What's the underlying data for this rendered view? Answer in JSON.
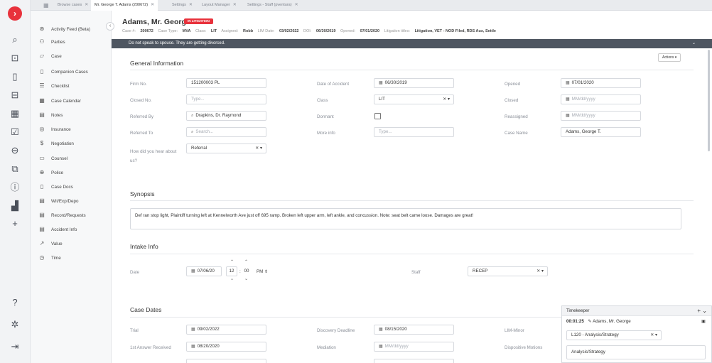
{
  "rail": {
    "logo": "›"
  },
  "tabs": [
    {
      "label": "Browse cases",
      "active": false
    },
    {
      "label": "Mr. George T. Adams (200672)",
      "active": true
    },
    {
      "label": "Settings",
      "active": false
    },
    {
      "label": "Layout Manager",
      "active": false
    },
    {
      "label": "Settings - Staff (pventura)",
      "active": false
    }
  ],
  "sidebar": {
    "items": [
      {
        "label": "Activity Feed (Beta)",
        "icon": "activity-feed-icon"
      },
      {
        "label": "Parties",
        "icon": "parties-icon"
      },
      {
        "label": "Case",
        "icon": "case-folder-icon"
      },
      {
        "label": "Companion Cases",
        "icon": "companion-cases-icon"
      },
      {
        "label": "Checklist",
        "icon": "checklist-icon"
      },
      {
        "label": "Case Calendar",
        "icon": "calendar-icon"
      },
      {
        "label": "Notes",
        "icon": "notes-icon"
      },
      {
        "label": "Insurance",
        "icon": "insurance-shield-icon"
      },
      {
        "label": "Negotiation",
        "icon": "negotiation-icon"
      },
      {
        "label": "Counsel",
        "icon": "counsel-icon"
      },
      {
        "label": "Police",
        "icon": "police-icon"
      },
      {
        "label": "Case Docs",
        "icon": "document-icon"
      },
      {
        "label": "Wit/Exp/Depo",
        "icon": "list-icon"
      },
      {
        "label": "Record/Requests",
        "icon": "list-icon"
      },
      {
        "label": "Accident Info",
        "icon": "list-icon"
      },
      {
        "label": "Value",
        "icon": "trend-icon"
      },
      {
        "label": "Time",
        "icon": "clock-icon"
      }
    ]
  },
  "header": {
    "name": "Adams, Mr. George T.",
    "badge": "IN LITIGATION",
    "meta": {
      "case_no_label": "Case #:",
      "case_no": "200672",
      "case_type_label": "Case Type:",
      "case_type": "MVA",
      "class_label": "Class:",
      "class": "LIT",
      "assigned_label": "Assigned:",
      "assigned": "Robb",
      "lim_label": "LIM Date:",
      "lim": "03/02/2022",
      "doi_label": "DOI:",
      "doi": "06/30/2019",
      "opened_label": "Opened:",
      "opened": "07/01/2020",
      "lit_label": "Litigation titles:",
      "lit": "Litigation, VET - NOD Filed, RDS Aux, Settle"
    }
  },
  "banner": "Do not speak to spouse. They are getting divorced.",
  "actions_label": "Actions",
  "general": {
    "title": "General Information",
    "firm_no_label": "Firm No.",
    "firm_no": "151200003 PL",
    "closed_no_label": "Closed No.",
    "closed_no_ph": "Type...",
    "referred_by_label": "Referred By",
    "referred_by": "Drapkins, Dr. Raymond",
    "referred_to_label": "Referred To",
    "referred_to_ph": "Search...",
    "hear_label": "How did you hear about us?",
    "hear": "Referral",
    "doa_label": "Date of Accident",
    "doa": "06/30/2019",
    "class_label": "Class",
    "class": "LIT",
    "dormant_label": "Dormant",
    "more_label": "More info",
    "more_ph": "Type...",
    "opened_label": "Opened",
    "opened": "07/01/2020",
    "closed_label": "Closed",
    "closed_ph": "MM/dd/yyyy",
    "reassigned_label": "Reassigned",
    "reassigned_ph": "MM/dd/yyyy",
    "case_name_label": "Case Name",
    "case_name": "Adams, George T."
  },
  "synopsis": {
    "title": "Synopsis",
    "text": "Def ran stop light, Plaintiff turning left at Kennelworth Ave just off 695 ramp.  Broken left upper arm, left ankle, and concussion.  Note: seat belt came loose.  Damages are great!"
  },
  "intake": {
    "title": "Intake Info",
    "date_label": "Date",
    "date": "07/06/20",
    "hour": "12",
    "minute": "00",
    "ampm": "PM",
    "staff_label": "Staff",
    "staff": "RECEP"
  },
  "dates": {
    "title": "Case Dates",
    "trial_label": "Trial",
    "trial": "09/02/2022",
    "first_answer_label": "1st Answer Received",
    "first_answer": "08/20/2020",
    "discovery_label": "Discovery Deadline",
    "discovery": "08/15/2020",
    "mediation_label": "Mediation",
    "mediation_ph": "MM/dd/yyyy",
    "lim_minor_label": "LIM-Minor",
    "dispositive_label": "Dispositive Motions"
  },
  "timekeeper": {
    "title": "Timekeeper",
    "elapsed": "00:01:25",
    "client": "Adams, Mr. George",
    "code": "L120 - Analysis/Strategy",
    "description": "Analysis/Strategy"
  }
}
